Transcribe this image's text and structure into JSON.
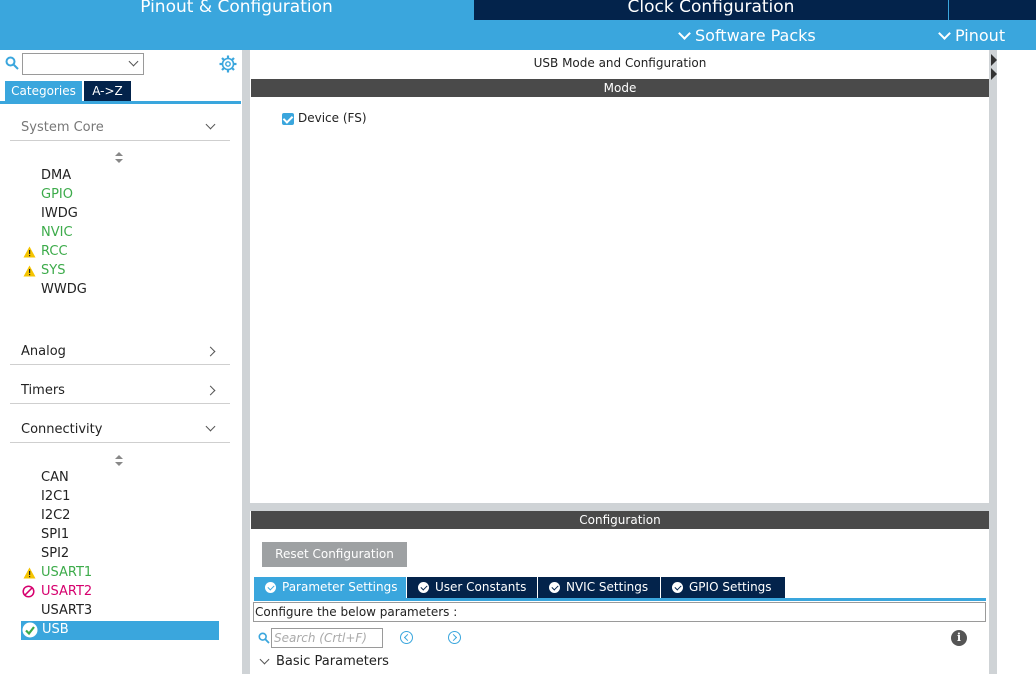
{
  "header": {
    "tabs": [
      {
        "label": "Pinout & Configuration",
        "active": true
      },
      {
        "label": "Clock Configuration",
        "active": false
      }
    ],
    "menu": {
      "software_packs": "Software Packs",
      "pinout": "Pinout"
    }
  },
  "sidebar": {
    "combo_value": "",
    "view_tabs": {
      "categories": "Categories",
      "az": "A->Z"
    },
    "sections": {
      "system_core": "System Core",
      "analog": "Analog",
      "timers": "Timers",
      "connectivity": "Connectivity"
    },
    "system_core_items": [
      {
        "label": "DMA",
        "state": "normal"
      },
      {
        "label": "GPIO",
        "state": "green"
      },
      {
        "label": "IWDG",
        "state": "normal"
      },
      {
        "label": "NVIC",
        "state": "green"
      },
      {
        "label": "RCC",
        "state": "warning"
      },
      {
        "label": "SYS",
        "state": "warning"
      },
      {
        "label": "WWDG",
        "state": "normal"
      }
    ],
    "connectivity_items": [
      {
        "label": "CAN",
        "state": "normal"
      },
      {
        "label": "I2C1",
        "state": "normal"
      },
      {
        "label": "I2C2",
        "state": "normal"
      },
      {
        "label": "SPI1",
        "state": "normal"
      },
      {
        "label": "SPI2",
        "state": "normal"
      },
      {
        "label": "USART1",
        "state": "warning"
      },
      {
        "label": "USART2",
        "state": "disabled"
      },
      {
        "label": "USART3",
        "state": "normal"
      },
      {
        "label": "USB",
        "state": "selected"
      }
    ]
  },
  "main": {
    "title": "USB Mode and Configuration",
    "mode_header": "Mode",
    "device_label": "Device (FS)",
    "device_checked": true,
    "config_header": "Configuration",
    "reset_label": "Reset Configuration",
    "param_tabs": [
      {
        "label": "Parameter Settings",
        "active": true
      },
      {
        "label": "User Constants",
        "active": false
      },
      {
        "label": "NVIC Settings",
        "active": false
      },
      {
        "label": "GPIO Settings",
        "active": false
      }
    ],
    "configure_text": "Configure the below parameters :",
    "search_placeholder": "Search (Crtl+F)",
    "basic_parameters": "Basic Parameters"
  },
  "colors": {
    "accent_blue": "#3aa6dd",
    "dark_navy": "#03234b",
    "ok_green": "#3cab4a",
    "warning_yellow": "#f5c400",
    "disabled_pink": "#d6006e"
  }
}
